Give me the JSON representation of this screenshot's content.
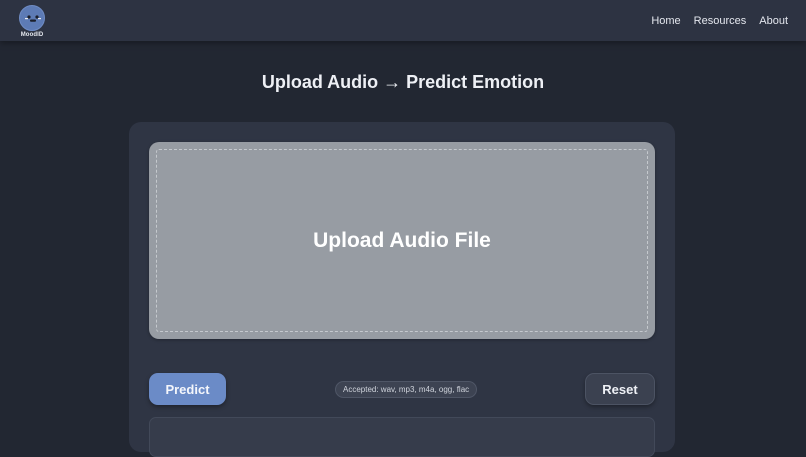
{
  "navbar": {
    "brand_name": "MoodID",
    "links": [
      {
        "label": "Home"
      },
      {
        "label": "Resources"
      },
      {
        "label": "About"
      }
    ]
  },
  "page": {
    "title": "Upload Audio → Predict Emotion"
  },
  "uploader": {
    "dropzone_label": "Upload Audio File",
    "predict_label": "Predict",
    "accepted_text": "Accepted: wav, mp3, m4a, ogg, flac",
    "reset_label": "Reset"
  },
  "colors": {
    "background": "#222732",
    "navbar": "#2d3342",
    "card": "#2f3544",
    "dropzone": "#979ca3",
    "accent": "#6b8bc7"
  }
}
